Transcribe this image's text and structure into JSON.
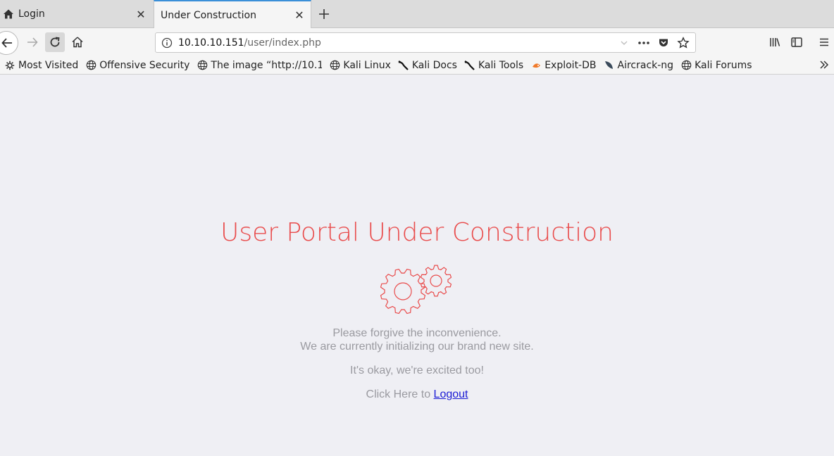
{
  "tabs": [
    {
      "label": "Login",
      "icon": "home-icon"
    },
    {
      "label": "Under Construction"
    }
  ],
  "url": {
    "host": "10.10.10.151",
    "path": "/user/index.php"
  },
  "bookmarks": [
    {
      "label": "Most Visited",
      "icon": "gear-icon"
    },
    {
      "label": "Offensive Security",
      "icon": "globe-icon"
    },
    {
      "label": "The image “http://10.1...",
      "icon": "globe-icon"
    },
    {
      "label": "Kali Linux",
      "icon": "globe-icon"
    },
    {
      "label": "Kali Docs",
      "icon": "kali-dragon-icon"
    },
    {
      "label": "Kali Tools",
      "icon": "kali-dragon-icon"
    },
    {
      "label": "Exploit-DB",
      "icon": "exploitdb-icon"
    },
    {
      "label": "Aircrack-ng",
      "icon": "aircrack-icon"
    },
    {
      "label": "Kali Forums",
      "icon": "globe-icon"
    }
  ],
  "page": {
    "heading": "User Portal Under Construction",
    "line1": "Please forgive the inconvenience.",
    "line2": "We are currently initializing our brand new site.",
    "line3": "It's okay, we're excited too!",
    "logout_prefix": "Click Here to",
    "logout_link": "Logout"
  },
  "colors": {
    "accent": "#e94c4c",
    "link": "#1a1ad4",
    "active_tab": "#3a8fd8"
  }
}
